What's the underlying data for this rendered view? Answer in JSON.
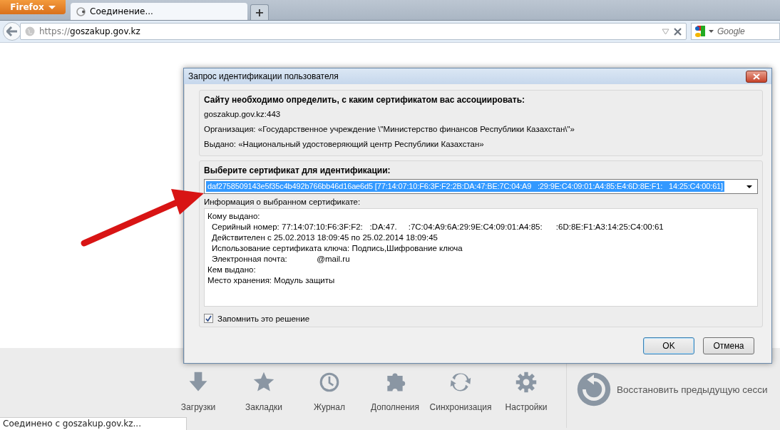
{
  "browser": {
    "menu_button": "Firefox",
    "tabs": [
      {
        "title": "Соединение...",
        "selected": true
      }
    ],
    "new_tab": "+",
    "url": {
      "scheme": "https://",
      "host": "goszakup.gov.kz"
    },
    "search": {
      "placeholder": "Google"
    }
  },
  "dialog": {
    "title": "Запрос идентификации пользователя",
    "request": {
      "heading": "Сайту необходимо определить, с каким сертификатом вас ассоциировать:",
      "lines": [
        "goszakup.gov.kz:443",
        "Организация: «Государственное учреждение \\\"Министерство финансов Республики Казахстан\\\"»",
        "Выдано: «Национальный удостоверяющий центр Республики Казахстан»"
      ]
    },
    "choose": {
      "heading": "Выберите сертификат для идентификации:",
      "certificate": "daf2758509143e5f35c4b492b766bb46d16ae6d5 [77:14:07:10:F6:3F:F2:2B:DA:47:BE:7C:04:A9   :29:9E:C4:09:01:A4:85:E4:6D:8E:F1:   14:25:C4:00:61]",
      "info_label": "Информация о выбранном сертификате:",
      "info": [
        {
          "text": "Кому выдано:",
          "children": [
            {
              "text": "Серийный номер: 77:14:07:10:F6:3F:F2:   :DA:47.     :7C:04:A9:6A:29:9E:C4:09:01:A4:85:      :6D:8E:F1:A3:14:25:C4:00:61"
            },
            {
              "text": "Действителен с 25.02.2013 18:09:45 по 25.02.2014 18:09:45"
            },
            {
              "text": "Использование сертификата ключа: Подпись,Шифрование ключа"
            },
            {
              "text": "Электронная почта:             @mail.ru"
            }
          ]
        },
        {
          "text": "Кем выдано:"
        },
        {
          "text": "Место хранения: Модуль защиты"
        }
      ],
      "remember": {
        "label": "Запомнить это решение",
        "checked": true
      }
    },
    "buttons": [
      {
        "label": "OK",
        "default": true
      },
      {
        "label": "Отмена",
        "default": false
      }
    ]
  },
  "launcher": {
    "items": [
      {
        "label": "Загрузки"
      },
      {
        "label": "Закладки"
      },
      {
        "label": "Журнал"
      },
      {
        "label": "Дополнения"
      },
      {
        "label": "Синхронизация"
      },
      {
        "label": "Настройки"
      }
    ],
    "restore": "Восстановить предыдущую сесси"
  },
  "status_bar": "Соединено с goszakup.gov.kz..."
}
